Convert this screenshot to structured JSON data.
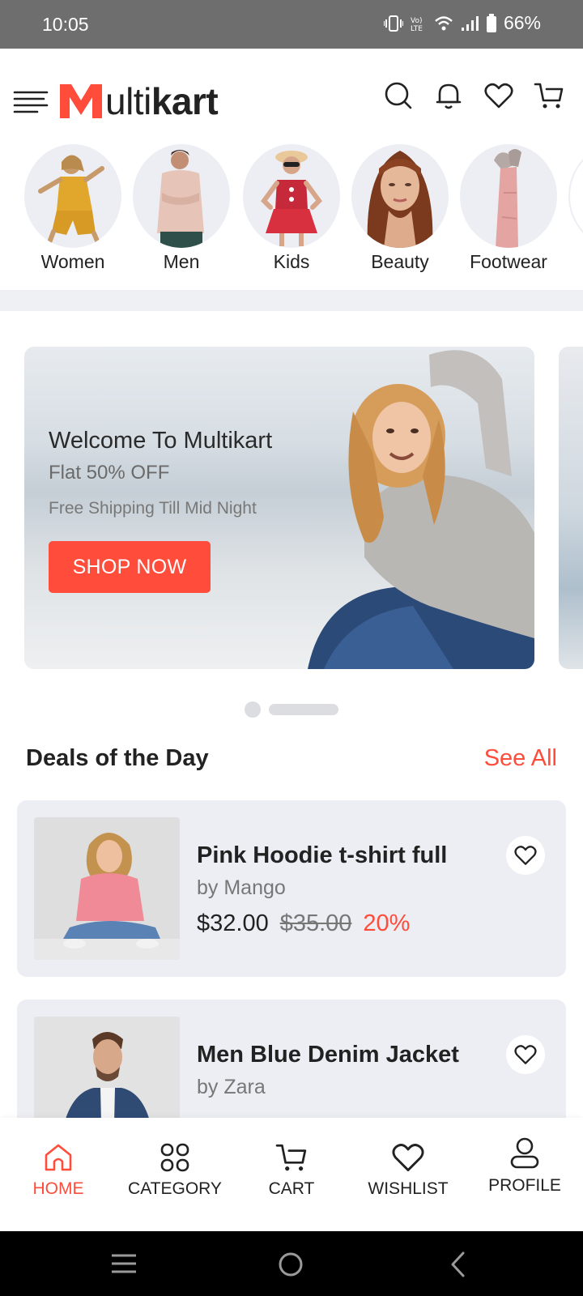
{
  "status_bar": {
    "time": "10:05",
    "battery": "66%"
  },
  "header": {
    "logo_letter": "M",
    "logo_thin": "ulti",
    "logo_bold": "kart",
    "icons": [
      "search-icon",
      "bell-icon",
      "heart-icon",
      "cart-icon"
    ]
  },
  "categories": [
    {
      "label": "Women"
    },
    {
      "label": "Men"
    },
    {
      "label": "Kids"
    },
    {
      "label": "Beauty"
    },
    {
      "label": "Footwear"
    }
  ],
  "banner": {
    "title": "Welcome To Multikart",
    "subtitle": "Flat 50% OFF",
    "tagline": "Free Shipping Till Mid Night",
    "button": "SHOP NOW"
  },
  "deals": {
    "title": "Deals of the Day",
    "see_all": "See All",
    "items": [
      {
        "name": "Pink Hoodie t-shirt full",
        "brand": "by Mango",
        "price": "$32.00",
        "mrp": "$35.00",
        "discount": "20%"
      },
      {
        "name": "Men Blue Denim Jacket",
        "brand": "by Zara"
      }
    ]
  },
  "bottom_nav": [
    {
      "label": "HOME",
      "active": true
    },
    {
      "label": "CATEGORY"
    },
    {
      "label": "CART"
    },
    {
      "label": "WISHLIST"
    },
    {
      "label": "PROFILE"
    }
  ],
  "colors": {
    "accent": "#ff4c3b",
    "card_bg": "#eceef3",
    "status_bar": "#6e6e6e"
  }
}
